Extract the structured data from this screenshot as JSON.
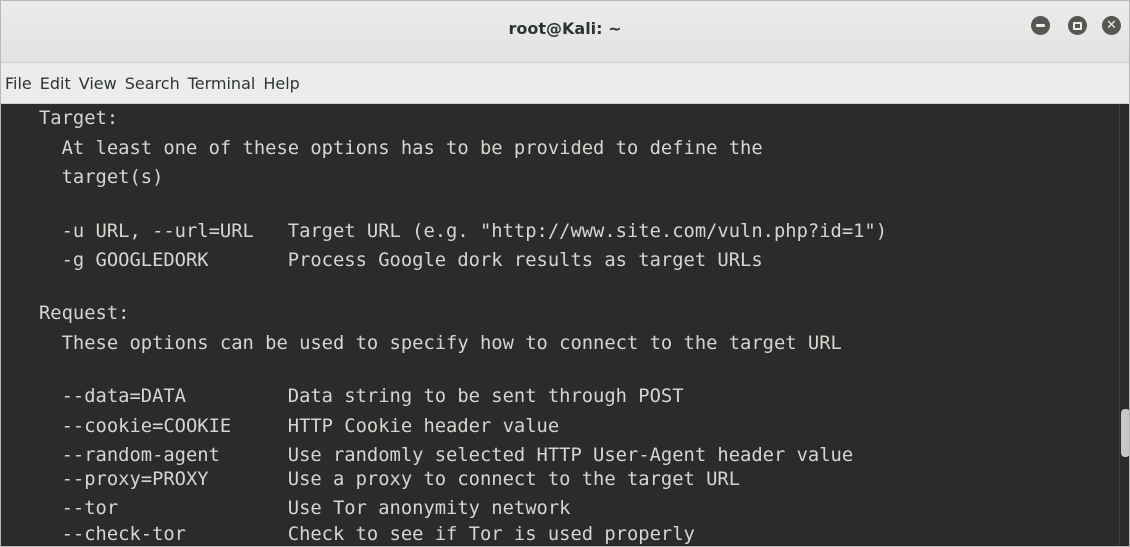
{
  "window": {
    "title": "root@Kali: ~"
  },
  "menu": [
    "File",
    "Edit",
    "View",
    "Search",
    "Terminal",
    "Help"
  ],
  "terminal": {
    "lines": [
      "Target:",
      "  At least one of these options has to be provided to define the",
      "  target(s)",
      "",
      "  -u URL, --url=URL   Target URL (e.g. \"http://www.site.com/vuln.php?id=1\")",
      "  -g GOOGLEDORK       Process Google dork results as target URLs",
      "",
      "Request:",
      "  These options can be used to specify how to connect to the target URL",
      "",
      "  --data=DATA         Data string to be sent through POST",
      "  --cookie=COOKIE     HTTP Cookie header value",
      "  --random-agent      Use randomly selected HTTP User-Agent header value",
      "  --proxy=PROXY       Use a proxy to connect to the target URL",
      "  --tor               Use Tor anonymity network",
      "  --check-tor         Check to see if Tor is used properly"
    ]
  },
  "icons": {
    "minimize": "minimize-icon",
    "maximize": "maximize-icon",
    "close": "close-icon"
  },
  "colors": {
    "terminal_bg": "#2b2b2b",
    "terminal_fg": "#d3d7cf",
    "titlebar_bg": "#ececec"
  }
}
